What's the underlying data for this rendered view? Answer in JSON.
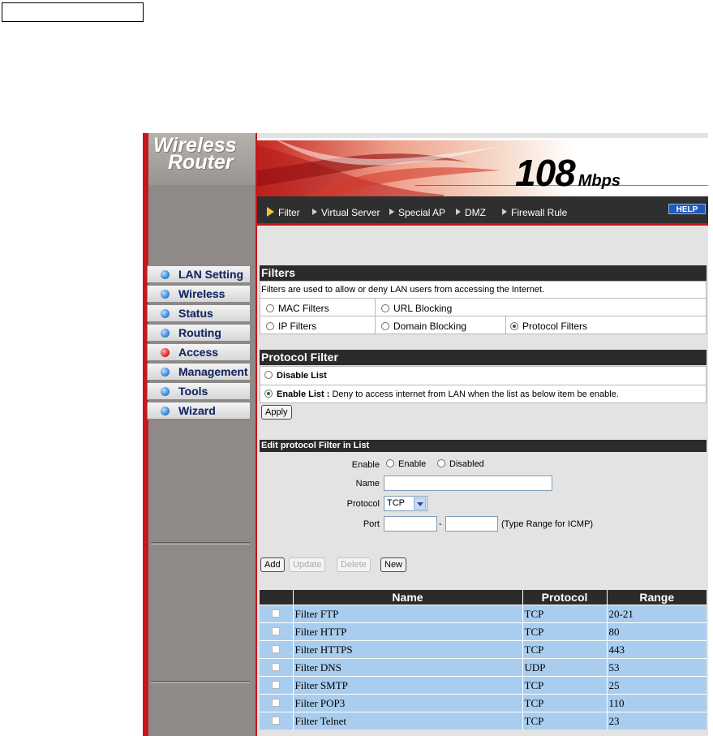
{
  "logo": {
    "line1": "Wireless",
    "line2": "Router"
  },
  "banner": {
    "speed": "108",
    "unit": "Mbps"
  },
  "tabs": [
    {
      "label": "Filter",
      "active": true
    },
    {
      "label": "Virtual Server",
      "active": false
    },
    {
      "label": "Special AP",
      "active": false
    },
    {
      "label": "DMZ",
      "active": false
    },
    {
      "label": "Firewall Rule",
      "active": false
    }
  ],
  "help": "HELP",
  "sidebar": {
    "items": [
      {
        "label": "LAN Setting",
        "active": false
      },
      {
        "label": "Wireless",
        "active": false
      },
      {
        "label": "Status",
        "active": false
      },
      {
        "label": "Routing",
        "active": false
      },
      {
        "label": "Access",
        "active": true
      },
      {
        "label": "Management",
        "active": false
      },
      {
        "label": "Tools",
        "active": false
      },
      {
        "label": "Wizard",
        "active": false
      }
    ]
  },
  "filters": {
    "header": "Filters",
    "description": "Filters are used to allow or deny LAN users from accessing the Internet.",
    "options": {
      "mac": "MAC Filters",
      "url": "URL Blocking",
      "ip": "IP Filters",
      "domain": "Domain Blocking",
      "protocol": "Protocol Filters"
    },
    "selected": "protocol"
  },
  "protocol_filter": {
    "header": "Protocol Filter",
    "disable_label": "Disable List",
    "enable_label": "Enable List :",
    "enable_desc": "Deny to access internet from LAN when the list as below item be enable.",
    "selected": "enable",
    "apply_label": "Apply"
  },
  "edit": {
    "header": "Edit protocol Filter in List",
    "enable_label": "Enable",
    "enable_option": "Enable",
    "disabled_option": "Disabled",
    "name_label": "Name",
    "name_value": "",
    "protocol_label": "Protocol",
    "protocol_value": "TCP",
    "port_label": "Port",
    "port_from": "",
    "port_to": "",
    "port_dash": "-",
    "port_hint": "(Type Range for ICMP)"
  },
  "actions": {
    "add": "Add",
    "update": "Update",
    "delete": "Delete",
    "new": "New"
  },
  "table": {
    "headers": {
      "check": "",
      "name": "Name",
      "protocol": "Protocol",
      "range": "Range"
    },
    "rows": [
      {
        "name": "Filter FTP",
        "protocol": "TCP",
        "range": "20-21"
      },
      {
        "name": "Filter HTTP",
        "protocol": "TCP",
        "range": "80"
      },
      {
        "name": "Filter HTTPS",
        "protocol": "TCP",
        "range": "443"
      },
      {
        "name": "Filter DNS",
        "protocol": "UDP",
        "range": "53"
      },
      {
        "name": "Filter SMTP",
        "protocol": "TCP",
        "range": "25"
      },
      {
        "name": "Filter POP3",
        "protocol": "TCP",
        "range": "110"
      },
      {
        "name": "Filter Telnet",
        "protocol": "TCP",
        "range": "23"
      }
    ]
  },
  "colors": {
    "frame_red": "#c8161d",
    "header_dark": "#2b2b2b",
    "row_blue": "#a8cdef"
  }
}
